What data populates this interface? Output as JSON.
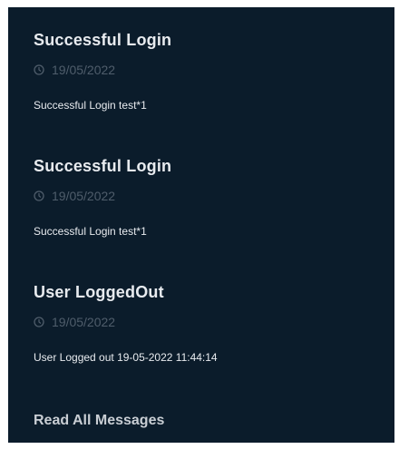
{
  "notifications": [
    {
      "title": "Successful Login",
      "date": "19/05/2022",
      "body": "Successful Login test*1"
    },
    {
      "title": "Successful Login",
      "date": "19/05/2022",
      "body": "Successful Login test*1"
    },
    {
      "title": "User LoggedOut",
      "date": "19/05/2022",
      "body": "User Logged out 19-05-2022 11:44:14"
    }
  ],
  "footer": {
    "read_all_label": "Read All Messages"
  },
  "colors": {
    "panel_background": "#0b1c2b",
    "title_text": "#e8ebef",
    "date_text": "#4f5d6b"
  },
  "icons": {
    "date": "clock-icon"
  }
}
